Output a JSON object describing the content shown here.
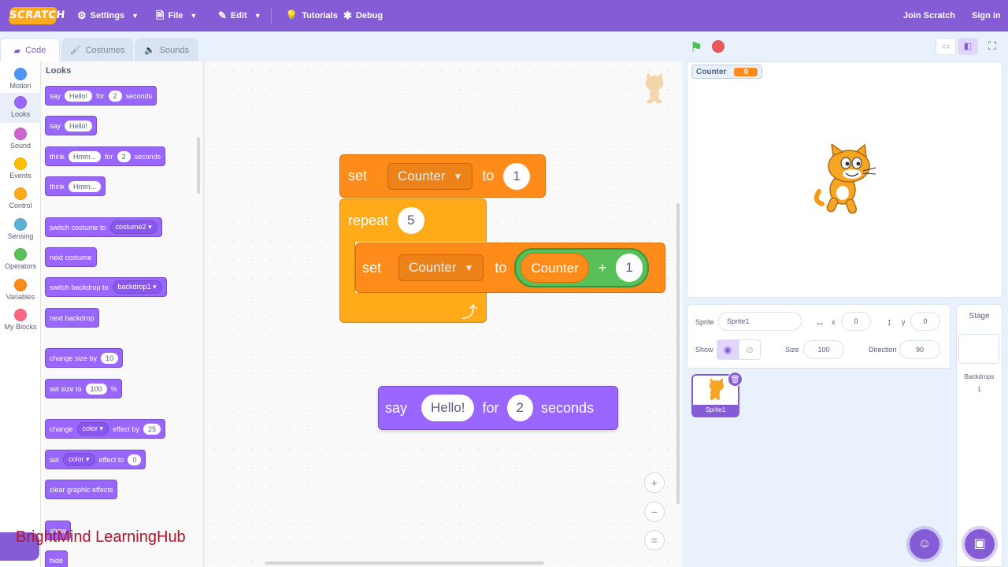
{
  "menubar": {
    "logo": "SCRATCH",
    "settings": "Settings",
    "file": "File",
    "edit": "Edit",
    "tutorials": "Tutorials",
    "debug": "Debug",
    "join": "Join Scratch",
    "signin": "Sign in"
  },
  "tabs": {
    "code": "Code",
    "costumes": "Costumes",
    "sounds": "Sounds"
  },
  "categories": [
    {
      "label": "Motion",
      "color": "#4c97ff"
    },
    {
      "label": "Looks",
      "color": "#9966ff"
    },
    {
      "label": "Sound",
      "color": "#cf63cf"
    },
    {
      "label": "Events",
      "color": "#ffbf00"
    },
    {
      "label": "Control",
      "color": "#ffab19"
    },
    {
      "label": "Sensing",
      "color": "#5cb1d6"
    },
    {
      "label": "Operators",
      "color": "#59c059"
    },
    {
      "label": "Variables",
      "color": "#ff8c1a"
    },
    {
      "label": "My Blocks",
      "color": "#ff6680"
    }
  ],
  "palette": {
    "title": "Looks",
    "b1": {
      "a": "say",
      "v1": "Hello!",
      "b": "for",
      "v2": "2",
      "c": "seconds"
    },
    "b2": {
      "a": "say",
      "v1": "Hello!"
    },
    "b3": {
      "a": "think",
      "v1": "Hmm...",
      "b": "for",
      "v2": "2",
      "c": "seconds"
    },
    "b4": {
      "a": "think",
      "v1": "Hmm..."
    },
    "b5": {
      "a": "switch costume to",
      "v1": "costume2"
    },
    "b6": {
      "a": "next costume"
    },
    "b7": {
      "a": "switch backdrop to",
      "v1": "backdrop1"
    },
    "b8": {
      "a": "next backdrop"
    },
    "b9": {
      "a": "change size by",
      "v1": "10"
    },
    "b10": {
      "a": "set size to",
      "v1": "100",
      "b": "%"
    },
    "b11": {
      "a": "change",
      "v1": "color",
      "b": "effect by",
      "v2": "25"
    },
    "b12": {
      "a": "set",
      "v1": "color",
      "b": "effect to",
      "v2": "0"
    },
    "b13": {
      "a": "clear graphic effects"
    },
    "b14": {
      "a": "show"
    },
    "b15": {
      "a": "hide"
    }
  },
  "script": {
    "set1": {
      "a": "set",
      "var": "Counter",
      "b": "to",
      "val": "1"
    },
    "repeat": {
      "a": "repeat",
      "val": "5"
    },
    "set2": {
      "a": "set",
      "var": "Counter",
      "b": "to",
      "rep": "Counter",
      "op": "+",
      "val": "1"
    },
    "say": {
      "a": "say",
      "v1": "Hello!",
      "b": "for",
      "v2": "2",
      "c": "seconds"
    }
  },
  "zoom": {
    "in": "+",
    "out": "−",
    "reset": "="
  },
  "watermark": "BrightMind LearningHub",
  "monitor": {
    "label": "Counter",
    "value": "0"
  },
  "spriteinfo": {
    "sprite_label": "Sprite",
    "sprite_name": "Sprite1",
    "x_label": "x",
    "x": "0",
    "y_label": "y",
    "y": "0",
    "show_label": "Show",
    "size_label": "Size",
    "size": "100",
    "direction_label": "Direction",
    "direction": "90"
  },
  "sprites": [
    {
      "name": "Sprite1"
    }
  ],
  "stagepane": {
    "title": "Stage",
    "backdrops_label": "Backdrops",
    "backdrops_count": "1"
  }
}
